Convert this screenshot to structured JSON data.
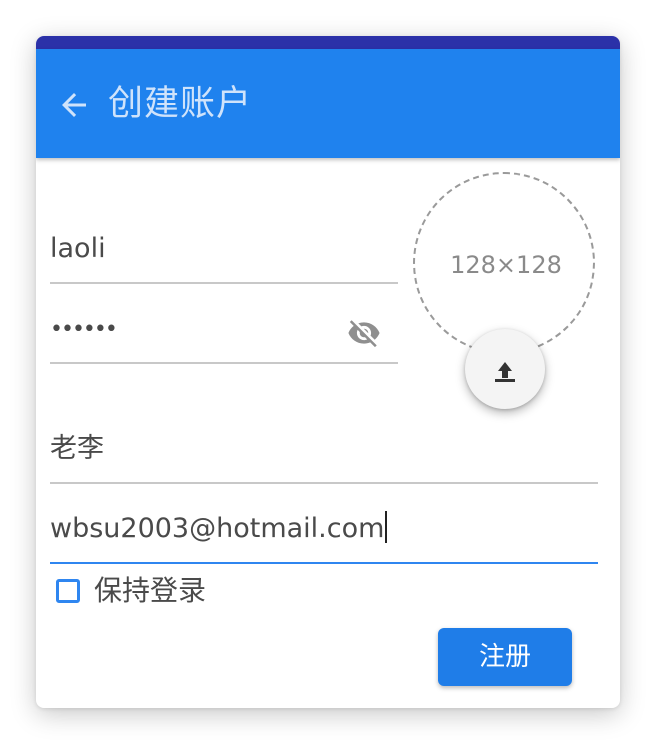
{
  "header": {
    "title": "创建账户",
    "back_icon": "arrow-left-icon"
  },
  "form": {
    "username_value": "laoli",
    "password_masked": "••••••",
    "password_visibility_icon": "eye-off-icon",
    "nickname_value": "老李",
    "email_value": "wbsu2003@hotmail.com",
    "avatar_size_label": "128×128",
    "upload_icon": "upload-icon",
    "remember_label": "保持登录",
    "remember_checked": false,
    "submit_label": "注册"
  },
  "colors": {
    "status_bar": "#2b31a8",
    "app_bar": "#1f82ee",
    "accent": "#2f86f0",
    "button": "#1f7de8"
  }
}
